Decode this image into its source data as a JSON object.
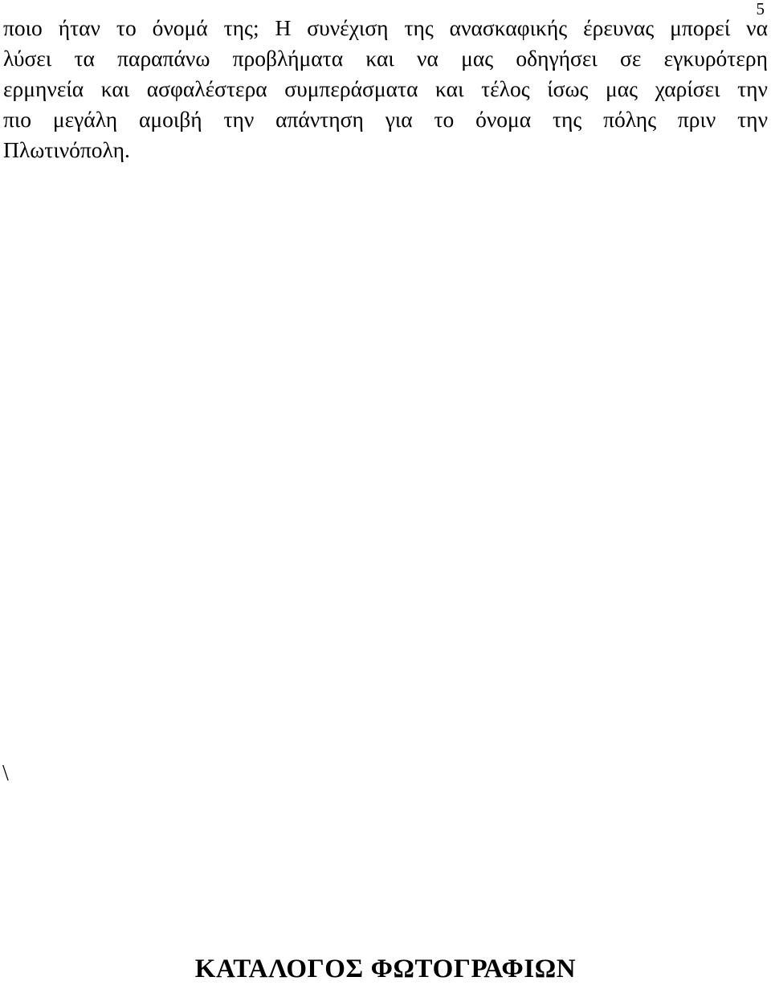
{
  "document": {
    "language": "Greek",
    "page_number": "5",
    "background_color": "#ffffff",
    "text_color": "#000000"
  },
  "header": {
    "page_number": "5"
  },
  "body": {
    "alignment": "justified",
    "lines": [
      "ποιο ήταν το όνομά της; Η συνέχιση της ανασκαφικής έρευνας μπορεί να",
      "λύσει τα παραπάνω προβλήματα και να μας οδηγήσει σε εγκυρότερη",
      "ερμηνεία και ασφαλέστερα συμπεράσματα και τέλος ίσως μας χαρίσει την",
      "πιο μεγάλη αμοιβή την απάντηση για το όνομα της πόλης πριν την",
      "Πλωτινόπολη."
    ],
    "full_text": "ποιο ήταν το όνομά της; Η συνέχιση της ανασκαφικής έρευνας μπορεί να λύσει τα παραπάνω προβλήματα και να μας οδηγήσει σε εγκυρότερη ερμηνεία και ασφαλέστερα συμπεράσματα και τέλος ίσως μας χαρίσει την πιο μεγάλη αμοιβή την απάντηση για το όνομα της πόλης πριν την Πλωτινόπολη."
  },
  "artifacts": {
    "stray_mark": "\\"
  },
  "footer": {
    "section_heading": "ΚΑΤΑΛΟΓΟΣ ΦΩΤΟΓΡΑΦΙΩΝ"
  }
}
